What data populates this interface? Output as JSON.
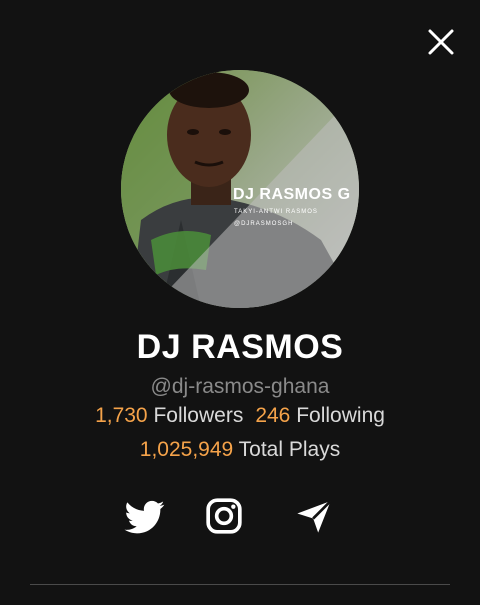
{
  "profile": {
    "name": "DJ RASMOS",
    "handle": "@dj-rasmos-ghana",
    "followers_count": "1,730",
    "followers_label": "Followers",
    "following_count": "246",
    "following_label": "Following",
    "plays_count": "1,025,949",
    "plays_label": "Total Plays"
  },
  "avatar_overlay": {
    "title": "DJ RASMOS G",
    "line1": "TAKYI-ANTWI RASMOS",
    "line2": "@DJRASMOSGH"
  },
  "icons": {
    "close": "close-icon",
    "twitter": "twitter-icon",
    "instagram": "instagram-icon",
    "share": "paper-plane-icon"
  },
  "colors": {
    "background": "#121212",
    "accent": "#f5a34a",
    "text": "#ffffff",
    "muted": "#8a8a8a",
    "divider": "#4a4a4a"
  }
}
